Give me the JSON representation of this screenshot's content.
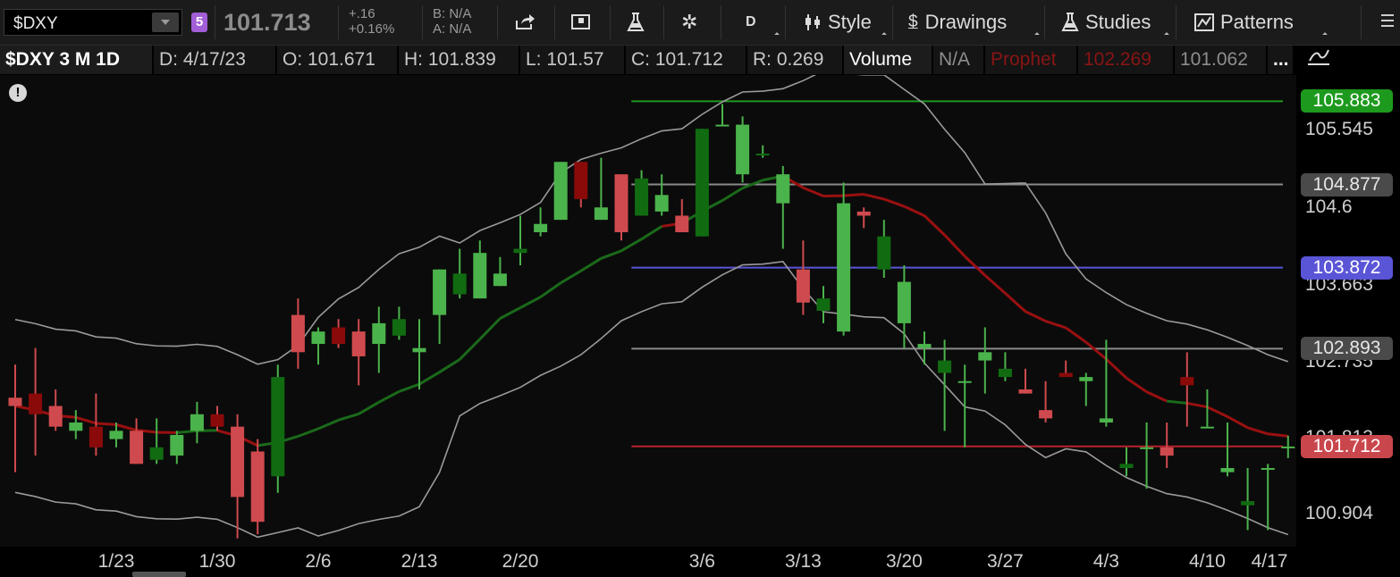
{
  "toolbar": {
    "symbol": "$DXY",
    "badge": "5",
    "last": "101.713",
    "change_abs": "+.16",
    "change_pct": "+0.16%",
    "bid": "B: N/A",
    "ask": "A: N/A",
    "period_btn": "D",
    "style": "Style",
    "drawings": "Drawings",
    "studies": "Studies",
    "patterns": "Patterns",
    "icons": [
      "share-icon",
      "flag-icon",
      "flask-icon",
      "gear-icon",
      "candle-icon",
      "dollar-icon",
      "flask-icon",
      "pattern-icon",
      "menu-icon"
    ]
  },
  "infobar": {
    "symbol_period": "$DXY 3 M 1D",
    "date": "D: 4/17/23",
    "open": "O: 101.671",
    "high": "H: 101.839",
    "low": "L: 101.57",
    "close": "C: 101.712",
    "range": "R: 0.269",
    "volume_label": "Volume",
    "volume_value": "N/A",
    "prophet_label": "Prophet",
    "prophet_value": "102.269",
    "prophet_value2": "101.062",
    "more": "..."
  },
  "chart_data": {
    "type": "candlestick",
    "ylim": [
      100.5,
      106.2
    ],
    "price_labels": [
      "105.545",
      "104.6",
      "103.663",
      "102.735",
      "101.813",
      "100.904"
    ],
    "price_tags": [
      {
        "value": 105.883,
        "text": "105.883",
        "color": "#1d9a1d",
        "fg": "#ffffff"
      },
      {
        "value": 104.877,
        "text": "104.877",
        "color": "#4a4a4a",
        "fg": "#e6e6e6"
      },
      {
        "value": 103.872,
        "text": "103.872",
        "color": "#5a55d6",
        "fg": "#ffffff"
      },
      {
        "value": 102.893,
        "text": "102.893",
        "color": "#4a4a4a",
        "fg": "#e6e6e6"
      },
      {
        "value": 101.712,
        "text": "101.712",
        "color": "#c9474c",
        "fg": "#ffffff"
      }
    ],
    "date_labels": [
      {
        "text": "1/23",
        "i": 5
      },
      {
        "text": "1/30",
        "i": 10
      },
      {
        "text": "2/6",
        "i": 15
      },
      {
        "text": "2/13",
        "i": 20
      },
      {
        "text": "2/20",
        "i": 25
      },
      {
        "text": "3/6",
        "i": 34
      },
      {
        "text": "3/13",
        "i": 39
      },
      {
        "text": "3/20",
        "i": 44
      },
      {
        "text": "3/27",
        "i": 49
      },
      {
        "text": "4/3",
        "i": 54
      },
      {
        "text": "4/10",
        "i": 59
      },
      {
        "text": "4/17",
        "i": 64
      }
    ],
    "candles": [
      [
        102.3,
        102.7,
        101.4,
        102.2
      ],
      [
        102.35,
        102.9,
        101.6,
        102.1
      ],
      [
        102.2,
        102.4,
        101.9,
        101.95
      ],
      [
        101.9,
        102.15,
        101.8,
        102.0
      ],
      [
        101.95,
        102.35,
        101.6,
        101.7
      ],
      [
        101.8,
        102.0,
        101.7,
        101.9
      ],
      [
        101.9,
        102.05,
        101.55,
        101.5
      ],
      [
        101.55,
        102.05,
        101.5,
        101.7
      ],
      [
        101.6,
        101.9,
        101.5,
        101.85
      ],
      [
        101.9,
        102.25,
        101.75,
        102.1
      ],
      [
        102.1,
        102.2,
        101.9,
        101.95
      ],
      [
        101.95,
        102.1,
        100.6,
        101.1
      ],
      [
        101.65,
        101.8,
        100.65,
        100.8
      ],
      [
        101.35,
        102.7,
        101.15,
        102.55
      ],
      [
        103.3,
        103.5,
        102.65,
        102.85
      ],
      [
        102.95,
        103.15,
        102.7,
        103.1
      ],
      [
        103.15,
        103.25,
        102.9,
        102.95
      ],
      [
        103.1,
        103.25,
        102.45,
        102.8
      ],
      [
        102.95,
        103.4,
        102.6,
        103.2
      ],
      [
        103.05,
        103.4,
        103.0,
        103.25
      ],
      [
        102.85,
        103.25,
        102.4,
        102.9
      ],
      [
        103.3,
        103.25,
        102.95,
        103.85
      ],
      [
        103.55,
        104.1,
        103.5,
        103.8
      ],
      [
        103.5,
        104.2,
        103.75,
        104.05
      ],
      [
        103.65,
        104.0,
        103.7,
        103.8
      ],
      [
        104.05,
        104.5,
        103.9,
        104.1
      ],
      [
        104.3,
        104.6,
        104.25,
        104.4
      ],
      [
        104.45,
        104.85,
        104.5,
        105.15
      ],
      [
        105.15,
        104.4,
        104.6,
        104.7
      ],
      [
        104.45,
        105.2,
        104.55,
        104.6
      ],
      [
        105.0,
        105.0,
        104.2,
        104.3
      ],
      [
        104.5,
        105.05,
        104.5,
        104.95
      ],
      [
        104.55,
        105.0,
        104.5,
        104.75
      ],
      [
        104.5,
        104.7,
        104.4,
        104.3
      ],
      [
        104.25,
        105.55,
        104.25,
        105.55
      ],
      [
        105.6,
        105.85,
        105.65,
        105.6
      ],
      [
        105.0,
        105.7,
        104.9,
        105.6
      ],
      [
        105.25,
        105.35,
        105.2,
        105.25
      ],
      [
        104.65,
        105.1,
        104.1,
        105.0
      ],
      [
        103.85,
        104.2,
        103.3,
        103.45
      ],
      [
        103.35,
        103.65,
        103.2,
        103.5
      ],
      [
        103.1,
        104.9,
        103.05,
        104.65
      ],
      [
        104.55,
        104.6,
        104.35,
        104.5
      ],
      [
        103.85,
        104.45,
        103.75,
        104.25
      ],
      [
        103.2,
        103.9,
        102.9,
        103.7
      ],
      [
        102.9,
        103.1,
        102.7,
        102.95
      ],
      [
        102.6,
        103.0,
        101.9,
        102.75
      ],
      [
        102.5,
        102.7,
        101.7,
        102.5
      ],
      [
        102.75,
        103.15,
        102.35,
        102.85
      ],
      [
        102.55,
        102.85,
        102.5,
        102.65
      ],
      [
        102.4,
        102.65,
        102.35,
        102.35
      ],
      [
        102.15,
        102.5,
        102.0,
        102.05
      ],
      [
        102.6,
        102.75,
        102.55,
        102.55
      ],
      [
        102.5,
        102.6,
        102.2,
        102.55
      ],
      [
        102.0,
        103.0,
        101.95,
        102.05
      ],
      [
        101.45,
        101.7,
        101.35,
        101.5
      ],
      [
        101.7,
        102.0,
        101.2,
        101.7
      ],
      [
        101.7,
        102.0,
        101.45,
        101.6
      ],
      [
        102.55,
        102.85,
        101.95,
        102.45
      ],
      [
        101.95,
        102.4,
        101.95,
        101.95
      ],
      [
        101.4,
        102.0,
        101.35,
        101.45
      ],
      [
        101.0,
        101.45,
        100.7,
        101.05
      ],
      [
        101.45,
        101.5,
        100.7,
        101.45
      ],
      [
        101.7,
        101.84,
        101.57,
        101.71
      ]
    ]
  },
  "chart_style": {
    "bg": "#0b0b0b",
    "up": "#4bb34b",
    "up_dark": "#116b11",
    "down": "#cf4a4e",
    "down_dark": "#8a0a0a",
    "upper_band": "#9a9a9a",
    "ma_green": "#1a6a1a",
    "ma_red": "#9a1010",
    "hline_green": "#1e9a1e",
    "hline_gray": "#8a8a8a",
    "hline_blue": "#5a55d6",
    "hline_red": "#b8232a"
  }
}
